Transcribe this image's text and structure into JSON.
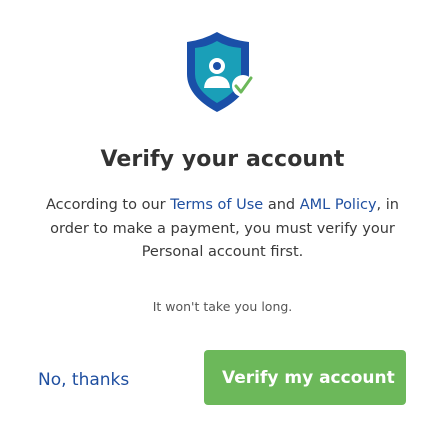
{
  "icon": {
    "name": "verified-shield-icon",
    "colors": {
      "shield_blue": "#1a4fa8",
      "shield_teal": "#1a9fb8",
      "check_green": "#6cb85a"
    }
  },
  "title": "Verify your account",
  "body": {
    "prefix": "According to our ",
    "terms_link": "Terms of Use",
    "middle": " and ",
    "aml_link": "AML Policy",
    "suffix": ", in order to make a payment, you must verify your Personal account first."
  },
  "hint": "It won't take you long.",
  "buttons": {
    "decline_label": "No, thanks",
    "verify_label": "Verify my account"
  },
  "colors": {
    "primary_green": "#6cb85a",
    "link_blue": "#1f4fa0"
  }
}
